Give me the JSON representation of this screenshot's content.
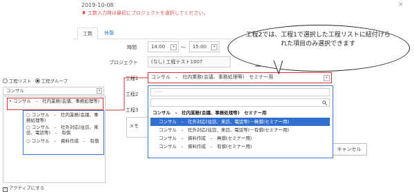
{
  "header": {
    "date": "2019-10-08",
    "close": "×",
    "warning": "工数入力時は最初にプロジェクトを選択してください。"
  },
  "tabs": [
    {
      "label": "工数"
    },
    {
      "label": "休憩"
    }
  ],
  "form": {
    "time_label": "時間",
    "time_start": "14:00",
    "time_sep": "～",
    "time_end": "15:00",
    "project_label": "プロジェクト",
    "project_value": "(なし) 工程テスト1007",
    "process1_label": "工程1",
    "process1_value": "コンサル　–　社内業務(会議、事務処理等)　セミナー用",
    "process2_label": "工程2",
    "process3_label": "工程3",
    "memo_label": "メモ",
    "cancel_label": "キャンセル"
  },
  "left_panel": {
    "radio_list_label": "工程リスト",
    "radio_group_label": "工程グループ",
    "filter_value": "コンサル",
    "tree_root": "コンサル　–　社内業務(会議、事務処理等)",
    "tree_children": [
      "コンサル　–　社内業務(会議、事務処理等)",
      "コンサル　–　社外対応(往訪、来訪、電話等)　–　有償",
      "コンサル　–　資料作成　–　有償"
    ],
    "active_label": "アクティブにする"
  },
  "bubble": {
    "text": "工程2では、工程1で選択した工程リストに紐付けられた項目のみ選択できます"
  },
  "dropdown": {
    "placeholder": "------",
    "group_header": "コンサル　–　社内業務(会議、事務処理等)　セミナー用",
    "options": [
      {
        "label": "コンサル　–　社外対応(往訪、来訪、電話等)－無償(セミナー用)",
        "selected": true
      },
      {
        "label": "コンサル　–　社外対応(往訪、来訪、電話等)－有償(セミナー用)",
        "selected": false
      },
      {
        "label": "コンサル　–　資料作成　–　無償(セミナー用)",
        "selected": false
      },
      {
        "label": "コンサル　–　資料作成　–　有償(セミナー用)",
        "selected": false
      }
    ]
  },
  "colors": {
    "red_highlight": "#e02b2b",
    "blue_highlight": "#2f6fd0",
    "link": "#2a74c9"
  }
}
